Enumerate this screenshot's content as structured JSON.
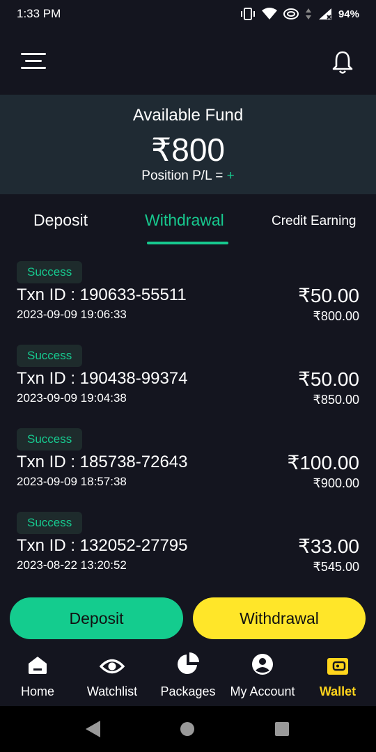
{
  "status_bar": {
    "time": "1:33 PM",
    "battery": "94%"
  },
  "fund": {
    "label": "Available Fund",
    "amount": "₹800",
    "pl_label": "Position P/L = ",
    "pl_value": "+"
  },
  "tabs": [
    {
      "label": "Deposit"
    },
    {
      "label": "Withdrawal"
    },
    {
      "label": "Credit Earning"
    }
  ],
  "transactions": [
    {
      "status": "Success",
      "txn_id": "Txn ID : 190633-55511",
      "datetime": "2023-09-09 19:06:33",
      "amount": "₹50.00",
      "balance": "₹800.00"
    },
    {
      "status": "Success",
      "txn_id": "Txn ID : 190438-99374",
      "datetime": "2023-09-09 19:04:38",
      "amount": "₹50.00",
      "balance": "₹850.00"
    },
    {
      "status": "Success",
      "txn_id": "Txn ID : 185738-72643",
      "datetime": "2023-09-09 18:57:38",
      "amount": "₹100.00",
      "balance": "₹900.00"
    },
    {
      "status": "Success",
      "txn_id": "Txn ID : 132052-27795",
      "datetime": "2023-08-22 13:20:52",
      "amount": "₹33.00",
      "balance": "₹545.00"
    }
  ],
  "actions": {
    "deposit": "Deposit",
    "withdrawal": "Withdrawal"
  },
  "nav": [
    {
      "label": "Home",
      "icon": "home-icon"
    },
    {
      "label": "Watchlist",
      "icon": "eye-icon"
    },
    {
      "label": "Packages",
      "icon": "pie-chart-icon"
    },
    {
      "label": "My Account",
      "icon": "account-icon"
    },
    {
      "label": "Wallet",
      "icon": "wallet-icon"
    }
  ],
  "colors": {
    "background": "#14151f",
    "panel": "#1f2a33",
    "accent_green": "#17c98f",
    "accent_yellow": "#ffe629",
    "wallet_active": "#ffd51c"
  }
}
